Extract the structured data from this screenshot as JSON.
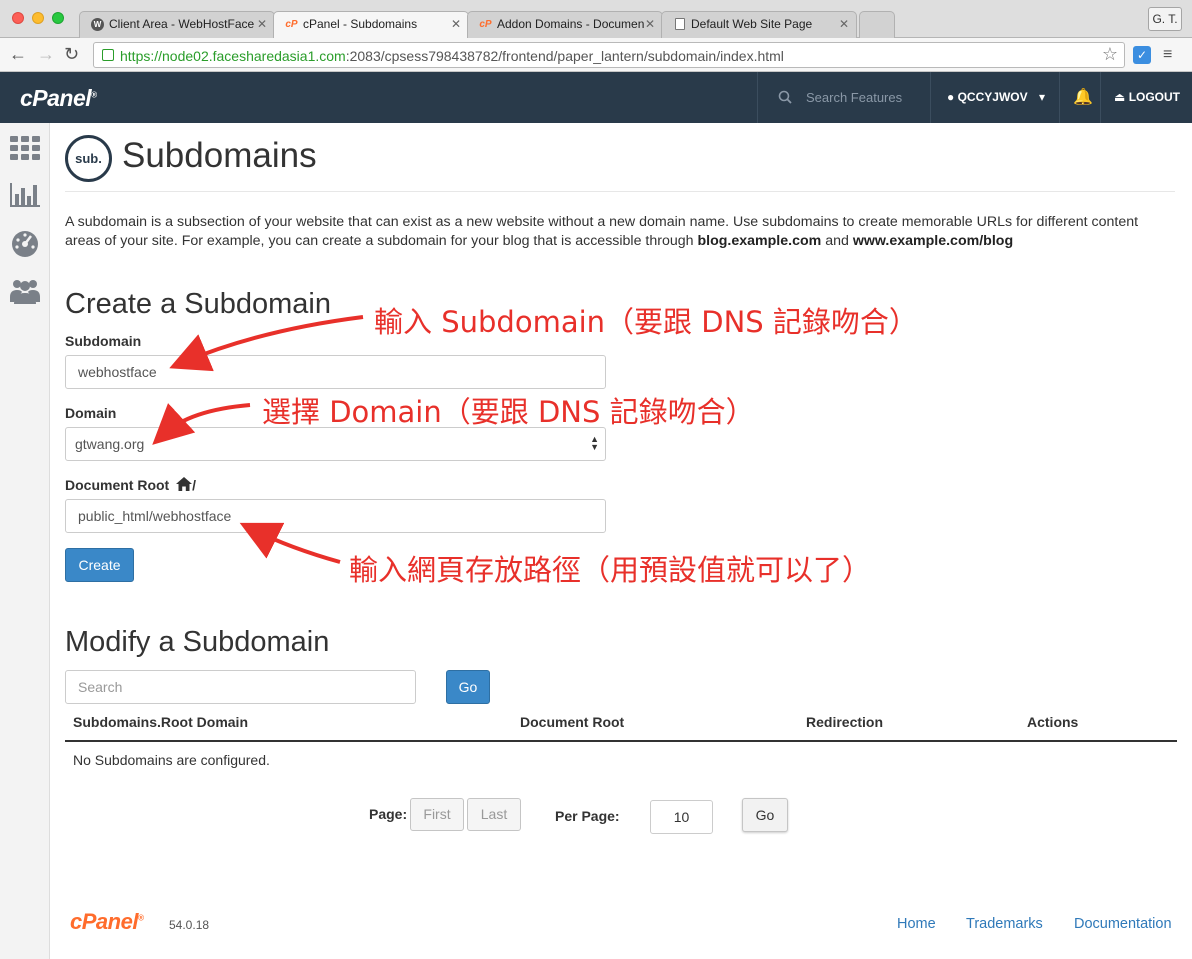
{
  "browser": {
    "tabs": [
      {
        "title": "Client Area - WebHostFace",
        "icon": "webhostface-favicon"
      },
      {
        "title": "cPanel - Subdomains",
        "icon": "cpanel-favicon"
      },
      {
        "title": "Addon Domains - Documen",
        "icon": "cpanel-favicon"
      },
      {
        "title": "Default Web Site Page",
        "icon": "document-icon"
      }
    ],
    "user_badge": "G. T.",
    "url_main": "https://node02.facesharedasia1.com",
    "url_rest": ":2083/cpsess798438782/frontend/paper_lantern/subdomain/index.html"
  },
  "header": {
    "logo": "cPanel",
    "search_placeholder": "Search Features",
    "user": "QCCYJWOV",
    "logout": "LOGOUT"
  },
  "page": {
    "icon_text": "sub.",
    "title": "Subdomains",
    "intro_text": "A subdomain is a subsection of your website that can exist as a new website without a new domain name. Use subdomains to create memorable URLs for different content areas of your site. For example, you can create a subdomain for your blog that is accessible through ",
    "intro_bold1": "blog.example.com",
    "intro_and": " and ",
    "intro_bold2": "www.example.com/blog"
  },
  "create": {
    "heading": "Create a Subdomain",
    "subdomain_label": "Subdomain",
    "subdomain_value": "webhostface",
    "domain_label": "Domain",
    "domain_value": "gtwang.org",
    "docroot_label": "Document Root",
    "docroot_suffix": "/",
    "docroot_value": "public_html/webhostface",
    "button": "Create"
  },
  "modify": {
    "heading": "Modify a Subdomain",
    "search_placeholder": "Search",
    "go": "Go",
    "columns": [
      "Subdomains.Root Domain",
      "Document Root",
      "Redirection",
      "Actions"
    ],
    "empty": "No Subdomains are configured."
  },
  "pagination": {
    "page_label": "Page:",
    "first": "First",
    "last": "Last",
    "per_page_label": "Per Page:",
    "per_page_value": "10",
    "go": "Go"
  },
  "footer": {
    "logo": "cPanel",
    "version": "54.0.18",
    "links": [
      "Home",
      "Trademarks",
      "Documentation"
    ]
  },
  "annotations": {
    "subdomain": "輸入 Subdomain（要跟 DNS 記錄吻合）",
    "domain": "選擇 Domain（要跟 DNS 記錄吻合）",
    "docroot": "輸入網頁存放路徑（用預設值就可以了）"
  },
  "colors": {
    "header_bg": "#293a4a",
    "primary_button": "#3a88c8",
    "annotation_red": "#e8302a",
    "cpanel_orange": "#ff6c2c",
    "link_blue": "#2f79b9"
  }
}
